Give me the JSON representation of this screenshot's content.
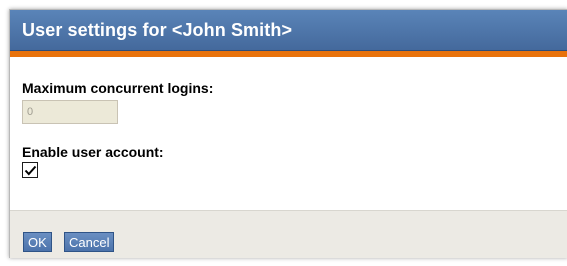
{
  "dialog": {
    "title": "User settings for <John Smith>"
  },
  "form": {
    "max_logins_label": "Maximum concurrent logins:",
    "max_logins_value": "0",
    "enable_account_label": "Enable user account:",
    "enable_account_checked": true
  },
  "footer": {
    "ok_label": "OK",
    "cancel_label": "Cancel"
  },
  "colors": {
    "titlebar": "#4f77ab",
    "accent_stripe": "#e8720c",
    "footer_bg": "#eceae4",
    "button_bg": "#5a80b6"
  },
  "icons": {
    "checkbox_mark": "checkmark-icon"
  }
}
